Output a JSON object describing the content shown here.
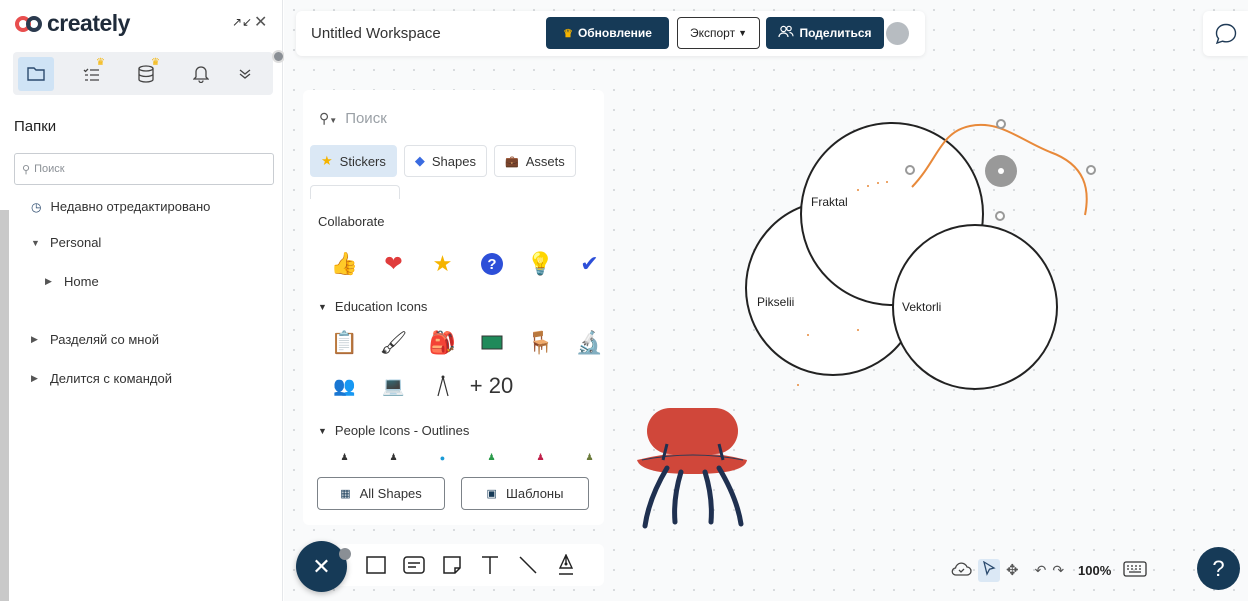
{
  "app": {
    "logo_text": "creately"
  },
  "sidebar": {
    "heading": "Папки",
    "search_placeholder": "Поиск",
    "recent": "Недавно отредактировано",
    "personal": "Personal",
    "home": "Home",
    "shared_with_me": "Разделяй со мной",
    "shared_team": "Делится с командой",
    "tabs": [
      "folder-icon",
      "tasks-icon",
      "database-icon",
      "bell-icon",
      "more-icon"
    ]
  },
  "topbar": {
    "title": "Untitled Workspace",
    "upgrade": "Обновление",
    "export": "Экспорт",
    "share": "Поделиться"
  },
  "panel": {
    "search_placeholder": "Поиск",
    "tabs": {
      "stickers": "Stickers",
      "shapes": "Shapes",
      "assets": "Assets"
    },
    "collaborate": "Collaborate",
    "education": "Education Icons",
    "education_more": "+ 20",
    "people": "People Icons - Outlines",
    "all_shapes": "All Shapes",
    "templates": "Шаблоны"
  },
  "diagram": {
    "circles": [
      "Fraktal",
      "Pikselii",
      "Vektorli"
    ]
  },
  "statusbar": {
    "zoom": "100%"
  },
  "colors": {
    "primary": "#163a57",
    "crown": "#f5b400",
    "orange_line": "#e8893a"
  }
}
